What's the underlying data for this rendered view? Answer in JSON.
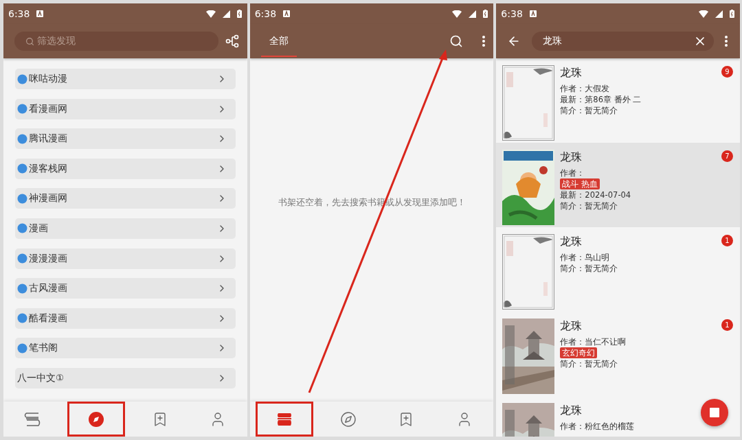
{
  "discover_screen": {
    "status_bar": {
      "time": "6:38"
    },
    "search": {
      "placeholder": "筛选发现"
    },
    "sources": [
      {
        "name": "咪咕动漫",
        "globe": true
      },
      {
        "name": "看漫画网",
        "globe": true
      },
      {
        "name": "腾讯漫画",
        "globe": true
      },
      {
        "name": "漫客栈网",
        "globe": true
      },
      {
        "name": "神漫画网",
        "globe": true
      },
      {
        "name": "漫画",
        "globe": true
      },
      {
        "name": "漫漫漫画",
        "globe": true
      },
      {
        "name": "古风漫画",
        "globe": true
      },
      {
        "name": "酷看漫画",
        "globe": true
      },
      {
        "name": "笔书阁",
        "globe": true
      },
      {
        "name": "八一中文①",
        "globe": false
      }
    ],
    "nav": [
      {
        "kind": "bookshelf",
        "selected": false,
        "highlighted": false
      },
      {
        "kind": "discover",
        "selected": true,
        "highlighted": true
      },
      {
        "kind": "bookmark",
        "selected": false,
        "highlighted": false
      },
      {
        "kind": "profile",
        "selected": false,
        "highlighted": false
      }
    ]
  },
  "bookshelf_screen": {
    "status_bar": {
      "time": "6:38"
    },
    "tabs": [
      {
        "label": "全部",
        "selected": true
      }
    ],
    "empty_message": "书架还空着，先去搜索书籍或从发现里添加吧！",
    "nav": [
      {
        "kind": "bookshelf",
        "selected": true,
        "highlighted": true
      },
      {
        "kind": "discover",
        "selected": false,
        "highlighted": false
      },
      {
        "kind": "bookmark",
        "selected": false,
        "highlighted": false
      },
      {
        "kind": "profile",
        "selected": false,
        "highlighted": false
      }
    ]
  },
  "search_screen": {
    "status_bar": {
      "time": "6:38"
    },
    "query": "龙珠",
    "results": [
      {
        "title": "龙珠",
        "selected": false,
        "badge": "9",
        "lines": [
          {
            "kind": "text",
            "text": "作者：大假发"
          },
          {
            "kind": "text",
            "text": "最新：第86章 番外 二"
          },
          {
            "kind": "text",
            "text": "简介：暂无简介"
          }
        ]
      },
      {
        "title": "龙珠",
        "selected": true,
        "badge": "7",
        "lines": [
          {
            "kind": "text",
            "text": "作者："
          },
          {
            "kind": "tag",
            "text": "战斗 热血"
          },
          {
            "kind": "text",
            "text": "最新：2024-07-04"
          },
          {
            "kind": "text",
            "text": "简介：暂无简介"
          }
        ]
      },
      {
        "title": "龙珠",
        "selected": false,
        "badge": "1",
        "lines": [
          {
            "kind": "text",
            "text": "作者：鸟山明"
          },
          {
            "kind": "text",
            "text": "简介：暂无简介"
          }
        ]
      },
      {
        "title": "龙珠",
        "selected": false,
        "badge": "1",
        "lines": [
          {
            "kind": "text",
            "text": "作者：当仁不让啊"
          },
          {
            "kind": "tag",
            "text": "玄幻奇幻"
          },
          {
            "kind": "text",
            "text": "简介：暂无简介"
          }
        ]
      },
      {
        "title": "龙珠",
        "selected": false,
        "lines": [
          {
            "kind": "text",
            "text": "作者：粉红色的榴莲"
          }
        ]
      }
    ]
  }
}
